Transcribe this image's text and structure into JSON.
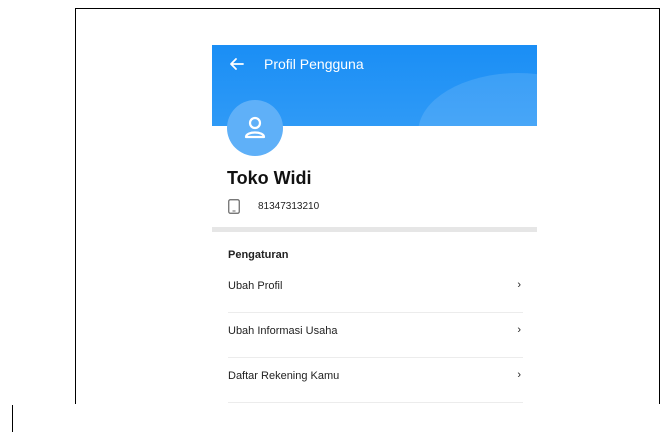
{
  "header": {
    "title": "Profil Pengguna",
    "back_icon": "arrow-left-icon",
    "color": "#1a8ef5"
  },
  "profile": {
    "avatar_icon": "user-icon",
    "name": "Toko Widi",
    "phone_icon": "phone-icon",
    "phone": "81347313210"
  },
  "settings": {
    "section_title": "Pengaturan",
    "items": [
      {
        "label": "Ubah Profil",
        "icon": "chevron-right-icon"
      },
      {
        "label": "Ubah Informasi Usaha",
        "icon": "chevron-right-icon"
      },
      {
        "label": "Daftar Rekening Kamu",
        "icon": "chevron-right-icon"
      }
    ]
  }
}
